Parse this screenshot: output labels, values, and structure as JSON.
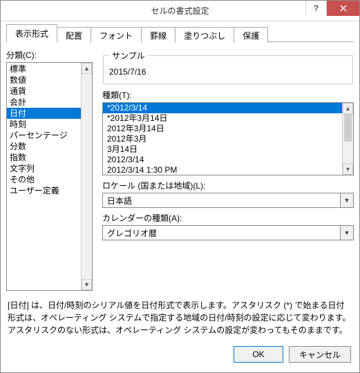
{
  "window": {
    "title": "セルの書式設定"
  },
  "tabs": [
    "表示形式",
    "配置",
    "フォント",
    "罫線",
    "塗りつぶし",
    "保護"
  ],
  "active_tab": 0,
  "category_label": "分類(C):",
  "categories": [
    "標準",
    "数値",
    "通貨",
    "会計",
    "日付",
    "時刻",
    "パーセンテージ",
    "分数",
    "指数",
    "文字列",
    "その他",
    "ユーザー定義"
  ],
  "selected_category": 4,
  "sample_label": "サンプル",
  "sample_value": "2015/7/16",
  "type_label": "種類(T):",
  "types": [
    "*2012/3/14",
    "*2012年3月14日",
    "2012年3月14日",
    "2012年3月",
    "3月14日",
    "2012/3/14",
    "2012/3/14 1:30 PM"
  ],
  "selected_type": 0,
  "locale_label": "ロケール (国または地域)(L):",
  "locale_value": "日本語",
  "calendar_label": "カレンダーの種類(A):",
  "calendar_value": "グレゴリオ暦",
  "description": "[日付] は、日付/時刻のシリアル値を日付形式で表示します。アスタリスク (*) で始まる日付形式は、オペレーティング システムで指定する地域の日付/時刻の設定に応じて変わります。アスタリスクのない形式は、オペレーティング システムの設定が変わってもそのままです。",
  "buttons": {
    "ok": "OK",
    "cancel": "キャンセル"
  }
}
